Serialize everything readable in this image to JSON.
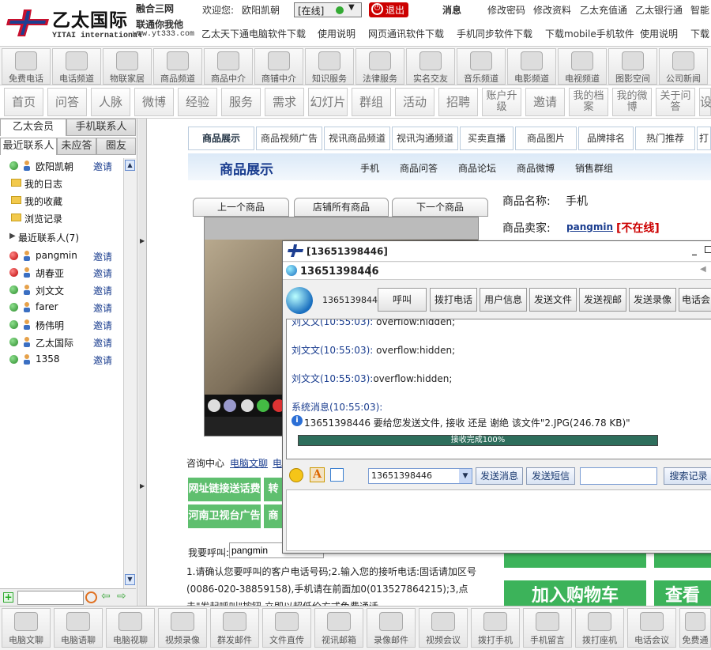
{
  "header": {
    "logo_cn": "乙太国际",
    "logo_en": "YITAI international",
    "slogan1": "融合三网",
    "slogan2": "联通你我他",
    "site": "www.yt333.com",
    "welcome": "欢迎您:",
    "username": "欧阳凯朝",
    "status": "[在线]",
    "logout": "退出",
    "messages": "消息",
    "top_links": [
      "修改密码",
      "修改资料",
      "乙太充值通",
      "乙太银行通",
      "智能"
    ],
    "download_links": [
      "乙太天下通电脑软件下载",
      "使用说明",
      "网页通讯软件下载",
      "手机同步软件下载",
      "下载mobile手机软件",
      "使用说明",
      "下载"
    ]
  },
  "iconbar": [
    "免费电话",
    "电话频道",
    "物联家居",
    "商品频道",
    "商品中介",
    "商铺中介",
    "知识服务",
    "法律服务",
    "实名交友",
    "音乐频道",
    "电影频道",
    "电视频道",
    "图影空间",
    "公司新闻"
  ],
  "navbar": [
    "首页",
    "问答",
    "人脉",
    "微博",
    "经验",
    "服务",
    "需求",
    "幻灯片",
    "群组",
    "活动",
    "招聘",
    "账户升级",
    "邀请",
    "我的档案",
    "我的微博",
    "关于问答",
    "设"
  ],
  "sidebar": {
    "tabs": [
      "乙太会员",
      "手机联系人",
      "最近联系人",
      "未应答",
      "圈友"
    ],
    "invite": "邀请",
    "top_contact": "欧阳凯朝",
    "folders": [
      "我的日志",
      "我的收藏",
      "浏览记录"
    ],
    "recent": "最近联系人(7)",
    "contacts": [
      {
        "name": "pangmin",
        "online": false
      },
      {
        "name": "胡春亚",
        "online": false
      },
      {
        "name": "刘文文",
        "online": true
      },
      {
        "name": "farer",
        "online": true
      },
      {
        "name": "杨伟明",
        "online": true
      },
      {
        "name": "乙太国际",
        "online": true
      },
      {
        "name": "1358",
        "online": true
      }
    ]
  },
  "main": {
    "tabs": [
      "商品展示",
      "商品视频广告",
      "视讯商品频道",
      "视讯沟通频道",
      "买卖直播",
      "商品图片",
      "品牌排名",
      "热门推荐",
      "打"
    ],
    "section_title": "商品展示",
    "subtabs": [
      "手机",
      "商品问答",
      "商品论坛",
      "商品微博",
      "销售群组"
    ],
    "prev": "上一个商品",
    "all": "店铺所有商品",
    "next": "下一个商品",
    "name_label": "商品名称:",
    "name_value": "手机",
    "seller_label": "商品卖家:",
    "seller_value": "pangmin",
    "seller_status": "不在线",
    "consult": "咨询中心",
    "consult_link": "电脑文聊",
    "consult_link2": "电",
    "green1": "网址链接送话费",
    "green1b": "转",
    "green2": "河南卫视台广告",
    "green2b": "商",
    "call_label": "我要呼叫:",
    "call_value": "pangmin",
    "instructions": "1.请确认您要呼叫的客户电话号码;2.输入您的接听电话:固话请加区号(0086-020-38859158),手机请在前面加0(013527864215);3,点击\"发起呼叫\"按钮,立即以超低价方式免费通话。",
    "cart": "加入购物车",
    "view": "查看"
  },
  "chat": {
    "title": "[13651398446]",
    "contact": "13651398446",
    "number": "1365139844",
    "buttons": [
      "呼叫",
      "拨打电话",
      "用户信息",
      "发送文件",
      "发送视邮",
      "发送录像",
      "电话会"
    ],
    "messages": [
      {
        "who": "刘文文(10:55:03):",
        "text": " overflow:hidden;"
      },
      {
        "who": "刘文文(10:55:03):",
        "text": " overflow:hidden;"
      },
      {
        "who": "刘文文(10:55:03):",
        "text": "overflow:hidden;"
      }
    ],
    "system_label": "系统消息(10:55:03):",
    "system_text": "13651398446 要给您发送文件, 接收 还是 谢绝 该文件\"2.JPG(246.78 KB)\"",
    "progress_text": "接收完成100%",
    "progress": 1.0,
    "recipient": "13651398446",
    "send_msg": "发送消息",
    "send_sms": "发送短信",
    "search": "搜索记录"
  },
  "bottombar": [
    "电脑文聊",
    "电脑语聊",
    "电脑视聊",
    "视频录像",
    "群发邮件",
    "文件直传",
    "视讯邮箱",
    "录像邮件",
    "视频会议",
    "拨打手机",
    "手机留言",
    "拨打座机",
    "电话会议",
    "免费通"
  ],
  "colors": {
    "accent": "#1a3d8f",
    "green": "#3cb35a",
    "red": "#cc0000"
  }
}
